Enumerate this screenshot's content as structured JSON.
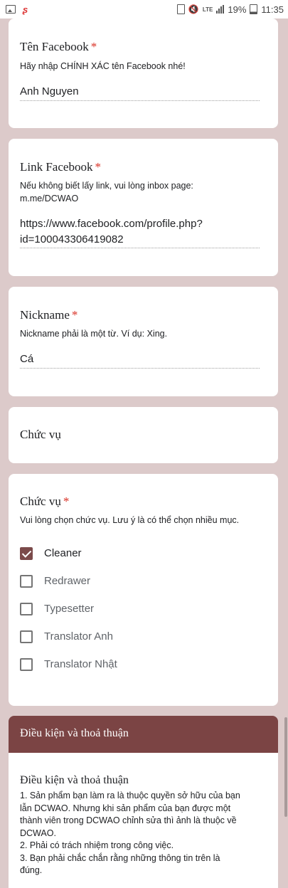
{
  "status_bar": {
    "left_icons": [
      "image-icon",
      "brand-icon"
    ],
    "right_icons": [
      "lock-icon",
      "mute-icon",
      "lte-icon",
      "signal-icon",
      "battery-icon"
    ],
    "lte": "LTE",
    "battery": "19%",
    "time": "11:35"
  },
  "questions": {
    "facebook_name": {
      "title": "Tên Facebook",
      "required": "*",
      "description": "Hãy nhập CHÍNH XÁC tên Facebook nhé!",
      "answer": "Anh Nguyen"
    },
    "facebook_link": {
      "title": "Link Facebook",
      "required": "*",
      "description_line1": "Nếu không biết lấy link, vui lòng inbox page:",
      "description_line2": "m.me/DCWAO",
      "answer_line1": "https://www.facebook.com/profile.php?",
      "answer_line2": "id=100043306419082"
    },
    "nickname": {
      "title": "Nickname",
      "required": "*",
      "description": "Nickname phải là một từ. Ví dụ: Xing.",
      "answer": "Cá"
    },
    "role_header": {
      "title": "Chức vụ"
    },
    "role": {
      "title": "Chức vụ",
      "required": "*",
      "description": "Vui lòng chọn chức vụ. Lưu ý là có thể chọn nhiều mục.",
      "options": [
        {
          "label": "Cleaner",
          "checked": true
        },
        {
          "label": "Redrawer",
          "checked": false
        },
        {
          "label": "Typesetter",
          "checked": false
        },
        {
          "label": "Translator Anh",
          "checked": false
        },
        {
          "label": "Translator Nhật",
          "checked": false
        }
      ]
    }
  },
  "section": {
    "header": "Điều kiện và thoả thuận",
    "title": "Điều kiện và thoả thuận",
    "lines": [
      "1. Sản phẩm bạn làm ra là thuộc quyền sở hữu của bạn",
      "lẫn DCWAO. Nhưng khi sản phẩm của bạn được một",
      "thành viên trong DCWAO chỉnh sửa thì ảnh là thuộc về",
      "DCWAO.",
      "2. Phải có trách nhiệm trong công việc.",
      "3. Bạn phải chắc chắn rằng những thông tin trên là",
      "đúng."
    ]
  },
  "colors": {
    "background": "#dccaca",
    "accent": "#7b4444",
    "required": "#d93025"
  }
}
